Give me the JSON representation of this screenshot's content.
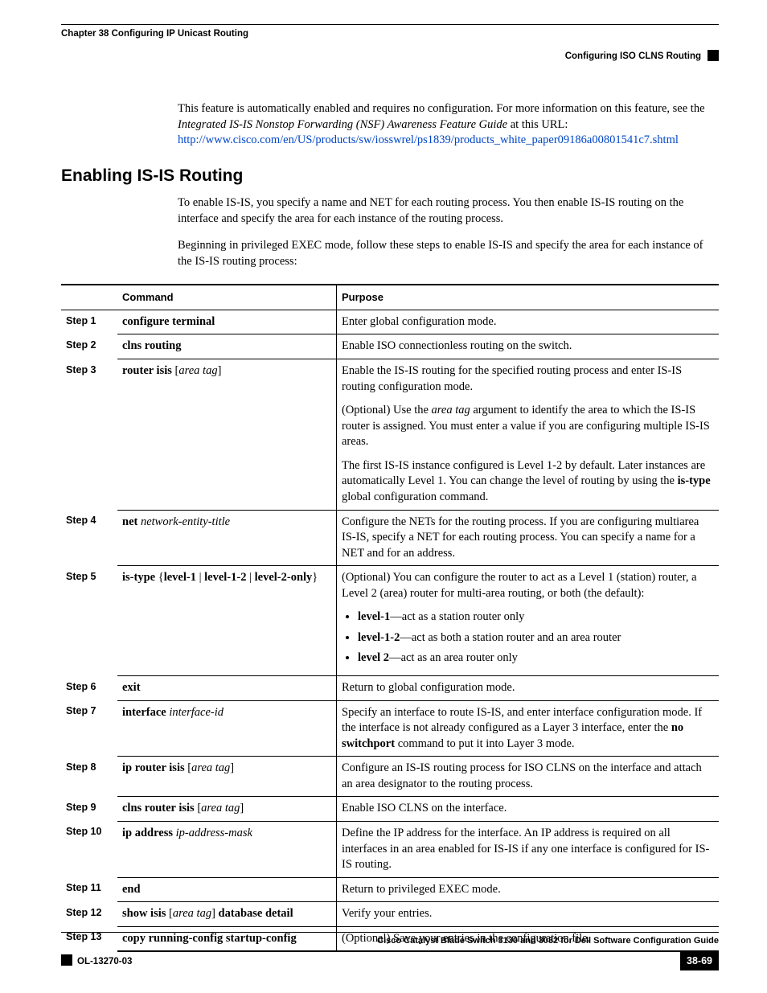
{
  "header": {
    "chapter": "Chapter 38    Configuring IP Unicast Routing",
    "section": "Configuring ISO CLNS Routing"
  },
  "intro": {
    "p1a": "This feature is automatically enabled and requires no configuration. For more information on this feature, see the ",
    "p1b": "Integrated IS-IS Nonstop Forwarding (NSF) Awareness Feature Guide",
    "p1c": " at this URL: ",
    "link": "http://www.cisco.com/en/US/products/sw/iosswrel/ps1839/products_white_paper09186a00801541c7.shtml"
  },
  "h2": "Enabling IS-IS Routing",
  "para1": "To enable IS-IS, you specify a name and NET for each routing process. You then enable IS-IS routing on the interface and specify the area for each instance of the routing process.",
  "para2": "Beginning in privileged EXEC mode, follow these steps to enable IS-IS and specify the area for each instance of the IS-IS routing process:",
  "table": {
    "head": {
      "c1": "Command",
      "c2": "Purpose"
    },
    "rows": {
      "s1": {
        "n": "Step 1",
        "cmd_b": "configure terminal",
        "purpose": "Enter global configuration mode."
      },
      "s2": {
        "n": "Step 2",
        "cmd_b": "clns routing",
        "purpose": "Enable ISO connectionless routing on the switch."
      },
      "s3": {
        "n": "Step 3",
        "cmd_b1": "router isis",
        "cmd_o1": " [",
        "cmd_i1": "area tag",
        "cmd_o2": "]",
        "p1": "Enable the IS-IS routing for the specified routing process and enter IS-IS routing configuration mode.",
        "p2a": "(Optional) Use the ",
        "p2b": "area tag",
        "p2c": " argument to identify the area to which the IS-IS router is assigned. You must enter a value if you are configuring multiple IS-IS areas.",
        "p3a": "The first IS-IS instance configured is Level 1-2 by default. Later instances are automatically Level 1. You can change the level of routing by using the ",
        "p3b": "is-type",
        "p3c": " global configuration command."
      },
      "s4": {
        "n": "Step 4",
        "cmd_b1": "net",
        "cmd_sp": " ",
        "cmd_i1": "network-entity-title",
        "purpose": "Configure the NETs for the routing process. If you are configuring multiarea IS-IS, specify a NET for each routing process. You can specify a name for a NET and for an address."
      },
      "s5": {
        "n": "Step 5",
        "cmd_b1": "is-type",
        "cmd_o1": " {",
        "cmd_b2": "level-1",
        "cmd_o2": " | ",
        "cmd_b3": "level-1-2",
        "cmd_o3": " | ",
        "cmd_b4": "level-2-only",
        "cmd_o4": "}",
        "p1": "(Optional) You can configure the router to act as a Level 1 (station) router, a Level 2 (area) router for multi-area routing, or both (the default):",
        "li1b": "level-1",
        "li1t": "—act as a station router only",
        "li2b": "level-1-2",
        "li2t": "—act as both a station router and an area router",
        "li3b": "level 2",
        "li3t": "—act as an area router only"
      },
      "s6": {
        "n": "Step 6",
        "cmd_b": "exit",
        "purpose": "Return to global configuration mode."
      },
      "s7": {
        "n": "Step 7",
        "cmd_b1": "interface",
        "cmd_sp": " ",
        "cmd_i1": "interface-id",
        "p1a": "Specify an interface to route IS-IS, and enter interface configuration mode. If the interface is not already configured as a Layer 3 interface, enter the ",
        "p1b": "no switchport",
        "p1c": " command to put it into Layer 3 mode."
      },
      "s8": {
        "n": "Step 8",
        "cmd_b1": "ip router isis",
        "cmd_o1": " [",
        "cmd_i1": "area tag",
        "cmd_o2": "]",
        "purpose": "Configure an IS-IS routing process for ISO CLNS on the interface and attach an area designator to the routing process."
      },
      "s9": {
        "n": "Step 9",
        "cmd_b1": "clns router isis",
        "cmd_o1": " [",
        "cmd_i1": "area tag",
        "cmd_o2": "]",
        "purpose": "Enable ISO CLNS on the interface."
      },
      "s10": {
        "n": "Step 10",
        "cmd_b1": "ip address",
        "cmd_sp": " ",
        "cmd_i1": "ip-address-mask",
        "purpose": "Define the IP address for the interface. An IP address is required on all interfaces in an area enabled for IS-IS if any one interface is configured for IS-IS routing."
      },
      "s11": {
        "n": "Step 11",
        "cmd_b": "end",
        "purpose": "Return to privileged EXEC mode."
      },
      "s12": {
        "n": "Step 12",
        "cmd_b1": "show isis",
        "cmd_o1": " [",
        "cmd_i1": "area tag",
        "cmd_o2": "] ",
        "cmd_b2": "database detail",
        "purpose": "Verify your entries."
      },
      "s13": {
        "n": "Step 13",
        "cmd_b": "copy running-config startup-config",
        "purpose": "(Optional) Save your entries in the configuration file."
      }
    }
  },
  "footer": {
    "title": "Cisco Catalyst Blade Switch 3130 and 3032 for Dell Software Configuration Guide",
    "ol": "OL-13270-03",
    "page": "38-69"
  }
}
